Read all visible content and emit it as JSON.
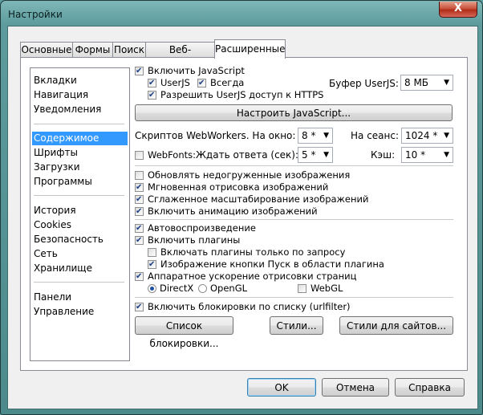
{
  "window": {
    "title": "Настройки",
    "close_glyph": "X"
  },
  "tabs": [
    "Основные",
    "Формы",
    "Поиск",
    "Веб-страницы",
    "Расширенные"
  ],
  "sidebar": {
    "group1": [
      "Вкладки",
      "Навигация",
      "Уведомления"
    ],
    "group2": [
      "Содержимое",
      "Шрифты",
      "Загрузки",
      "Программы"
    ],
    "group3": [
      "История",
      "Cookies",
      "Безопасность",
      "Сеть",
      "Хранилище"
    ],
    "group4": [
      "Панели",
      "Управление"
    ],
    "selected": "Содержимое"
  },
  "js": {
    "enable": "Включить JavaScript",
    "userjs": "UserJS",
    "always": "Всегда",
    "https": "Разрешить UserJS доступ к HTTPS",
    "buffer_label": "Буфер UserJS:",
    "buffer_value": "8 МБ",
    "configure": "Настроить JavaScript..."
  },
  "workers": {
    "label": "Скриптов WebWorkers. На окно:",
    "per_window": "8 *",
    "session_label": "На сеанс:",
    "per_session": "1024 *"
  },
  "webfonts": {
    "label": "WebFonts:",
    "wait_label": "Ждать ответа (сек):",
    "wait_value": "5 *",
    "cache_label": "Кэш:",
    "cache_value": "10 *"
  },
  "images": {
    "update": "Обновлять недогруженные изображения",
    "instant": "Мгновенная отрисовка изображений",
    "smooth": "Сглаженное масштабирование изображений",
    "animation": "Включить анимацию изображений"
  },
  "plugins": {
    "autoplay": "Автовоспроизведение",
    "enable": "Включить плагины",
    "on_demand": "Включать плагины только по запросу",
    "start_button": "Изображение кнопки Пуск в области плагина",
    "hw_accel": "Аппаратное ускорение отрисовки страниц",
    "directx": "DirectX",
    "opengl": "OpenGL",
    "webgl": "WebGL"
  },
  "blocking": {
    "enable": "Включить блокировки по списку (urlfilter)",
    "list_button": "Список блокировки...",
    "styles_button": "Стили...",
    "site_styles_button": "Стили для сайтов..."
  },
  "footer": {
    "ok": "OK",
    "cancel": "Отмена",
    "help": "Справка"
  }
}
